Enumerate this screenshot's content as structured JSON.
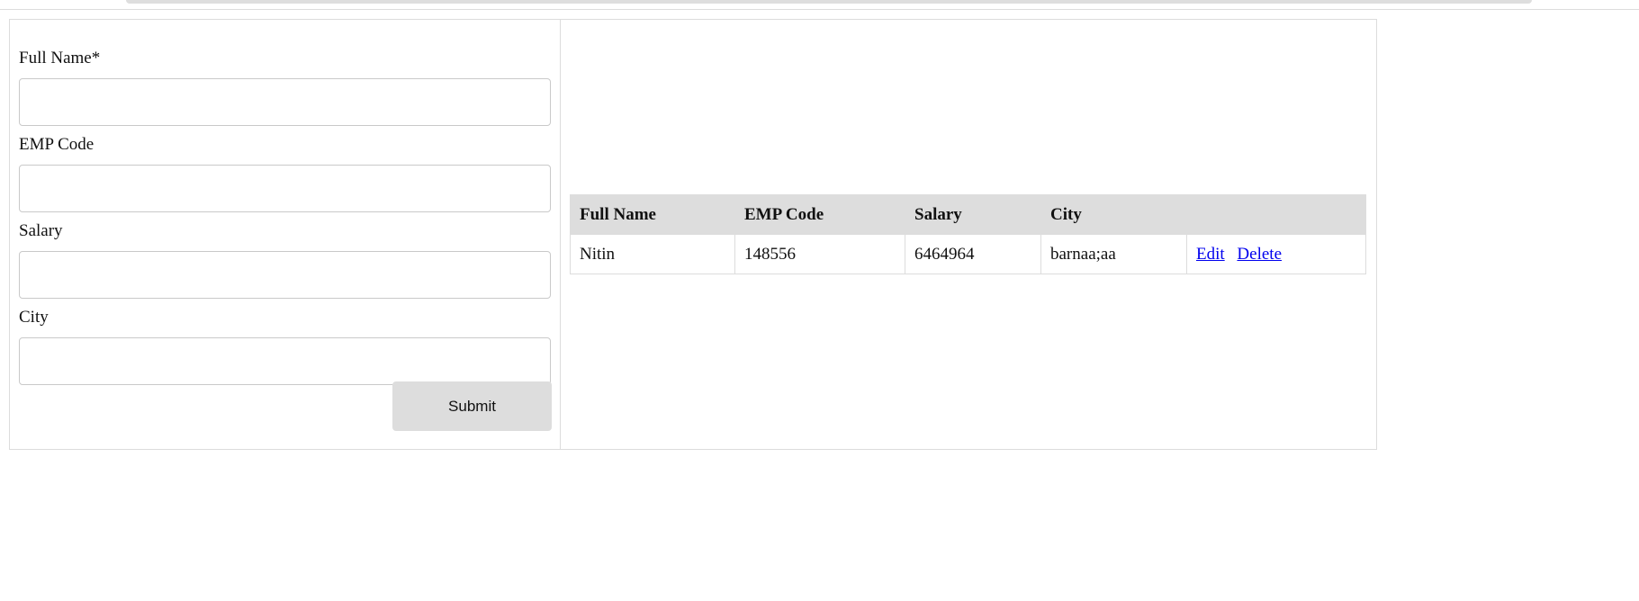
{
  "form": {
    "fields": [
      {
        "label": "Full Name*",
        "value": "",
        "placeholder": ""
      },
      {
        "label": "EMP Code",
        "value": "",
        "placeholder": ""
      },
      {
        "label": "Salary",
        "value": "",
        "placeholder": ""
      },
      {
        "label": "City",
        "value": "",
        "placeholder": ""
      }
    ],
    "submit_label": "Submit"
  },
  "table": {
    "headers": [
      "Full Name",
      "EMP Code",
      "Salary",
      "City",
      ""
    ],
    "rows": [
      {
        "full_name": "Nitin",
        "emp_code": "148556",
        "salary": "6464964",
        "city": "barnaa;aa",
        "edit_label": "Edit",
        "delete_label": "Delete"
      }
    ]
  }
}
